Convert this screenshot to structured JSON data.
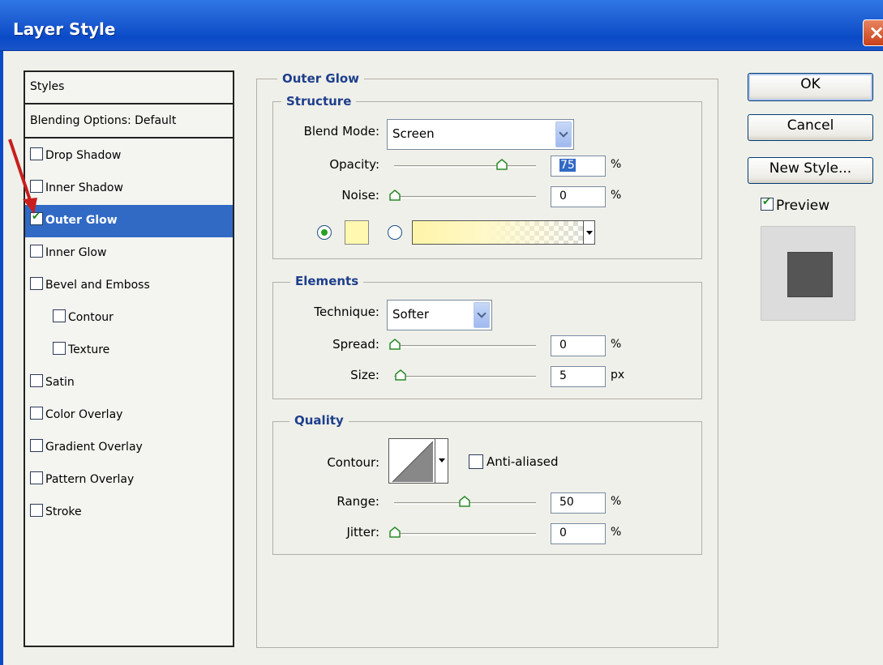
{
  "window": {
    "title": "Layer Style",
    "close_glyph": "×"
  },
  "styles_panel": {
    "header": "Styles",
    "blending": "Blending Options: Default",
    "items": [
      {
        "label": "Drop Shadow",
        "checked": false,
        "indent": false
      },
      {
        "label": "Inner Shadow",
        "checked": false,
        "indent": false
      },
      {
        "label": "Outer Glow",
        "checked": true,
        "indent": false,
        "selected": true
      },
      {
        "label": "Inner Glow",
        "checked": false,
        "indent": false
      },
      {
        "label": "Bevel and Emboss",
        "checked": false,
        "indent": false
      },
      {
        "label": "Contour",
        "checked": false,
        "indent": true
      },
      {
        "label": "Texture",
        "checked": false,
        "indent": true
      },
      {
        "label": "Satin",
        "checked": false,
        "indent": false
      },
      {
        "label": "Color Overlay",
        "checked": false,
        "indent": false
      },
      {
        "label": "Gradient Overlay",
        "checked": false,
        "indent": false
      },
      {
        "label": "Pattern Overlay",
        "checked": false,
        "indent": false
      },
      {
        "label": "Stroke",
        "checked": false,
        "indent": false
      }
    ]
  },
  "outer_glow": {
    "title": "Outer Glow",
    "structure": {
      "title": "Structure",
      "blend_mode_label": "Blend Mode:",
      "blend_mode_value": "Screen",
      "opacity_label": "Opacity:",
      "opacity_value": "75",
      "opacity_unit": "%",
      "noise_label": "Noise:",
      "noise_value": "0",
      "noise_unit": "%",
      "glow_color": "#fff8b0"
    },
    "elements": {
      "title": "Elements",
      "technique_label": "Technique:",
      "technique_value": "Softer",
      "spread_label": "Spread:",
      "spread_value": "0",
      "spread_unit": "%",
      "size_label": "Size:",
      "size_value": "5",
      "size_unit": "px"
    },
    "quality": {
      "title": "Quality",
      "contour_label": "Contour:",
      "anti_aliased_label": "Anti-aliased",
      "anti_aliased_checked": false,
      "range_label": "Range:",
      "range_value": "50",
      "range_unit": "%",
      "jitter_label": "Jitter:",
      "jitter_value": "0",
      "jitter_unit": "%"
    }
  },
  "buttons": {
    "ok": "OK",
    "cancel": "Cancel",
    "new_style": "New Style...",
    "preview_label": "Preview",
    "preview_checked": true
  },
  "colors": {
    "title_bar": "#0a4ac8",
    "selected_row": "#316ac5",
    "legend_text": "#1e3f8c",
    "annotation_arrow": "#c81e1e"
  }
}
